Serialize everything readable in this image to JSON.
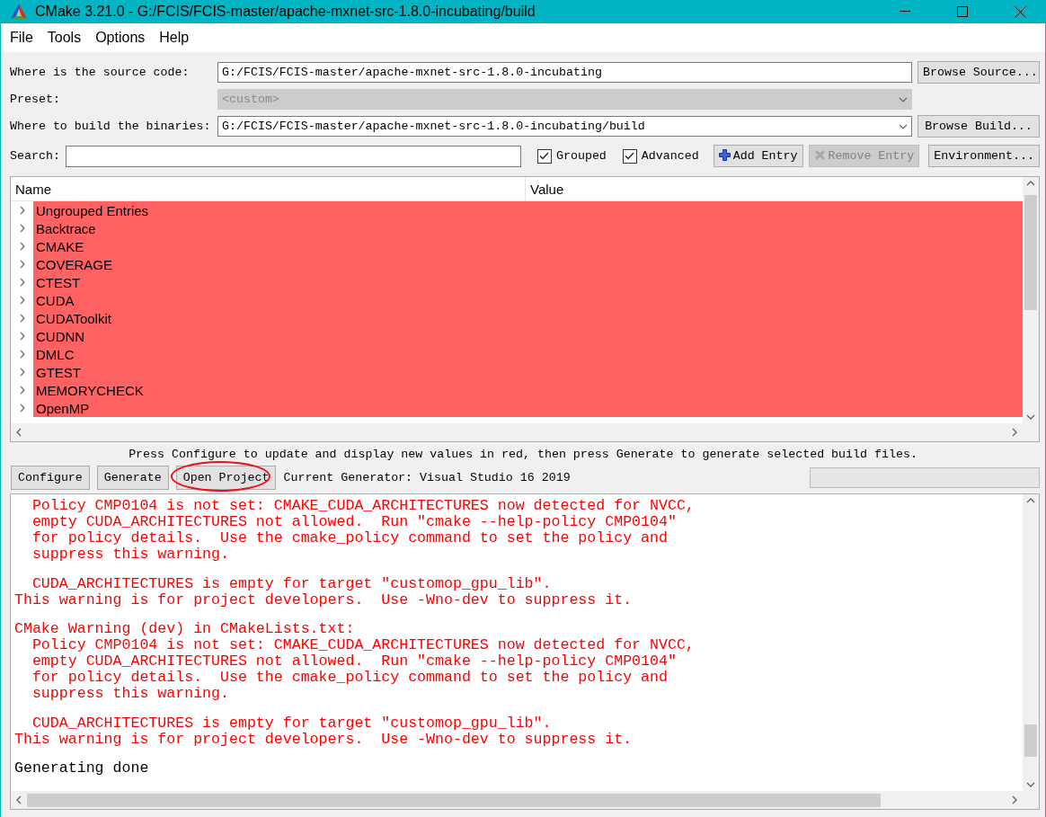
{
  "window": {
    "title": "CMake 3.21.0 - G:/FCIS/FCIS-master/apache-mxnet-src-1.8.0-incubating/build"
  },
  "menu": [
    "File",
    "Tools",
    "Options",
    "Help"
  ],
  "paths": [
    {
      "kind": "text",
      "label": "Where is the source code:",
      "value": "G:/FCIS/FCIS-master/apache-mxnet-src-1.8.0-incubating",
      "disabled": false,
      "button": "Browse Source..."
    },
    {
      "kind": "combo",
      "label": "Preset:",
      "value": "<custom>",
      "disabled": true
    },
    {
      "kind": "combo",
      "label": "Where to build the binaries:",
      "value": "G:/FCIS/FCIS-master/apache-mxnet-src-1.8.0-incubating/build",
      "disabled": false,
      "button": "Browse Build..."
    }
  ],
  "search": {
    "label": "Search:"
  },
  "options": [
    {
      "label": "Grouped",
      "checked": true
    },
    {
      "label": "Advanced",
      "checked": true
    }
  ],
  "entry_buttons": [
    {
      "kind": "add",
      "label": "Add Entry",
      "disabled": false
    },
    {
      "kind": "remove",
      "label": "Remove Entry",
      "disabled": true
    },
    {
      "kind": "plain",
      "label": "Environment...",
      "disabled": false
    }
  ],
  "table": {
    "columns": [
      "Name",
      "Value"
    ],
    "rows": [
      {
        "name": "Ungrouped Entries",
        "expanded": false,
        "changed": true
      },
      {
        "name": "Backtrace",
        "expanded": false,
        "changed": true
      },
      {
        "name": "CMAKE",
        "expanded": false,
        "changed": true
      },
      {
        "name": "COVERAGE",
        "expanded": false,
        "changed": true
      },
      {
        "name": "CTEST",
        "expanded": false,
        "changed": true
      },
      {
        "name": "CUDA",
        "expanded": false,
        "changed": true
      },
      {
        "name": "CUDAToolkit",
        "expanded": false,
        "changed": true
      },
      {
        "name": "CUDNN",
        "expanded": false,
        "changed": true
      },
      {
        "name": "DMLC",
        "expanded": false,
        "changed": true
      },
      {
        "name": "GTEST",
        "expanded": false,
        "changed": true
      },
      {
        "name": "MEMORYCHECK",
        "expanded": false,
        "changed": true
      },
      {
        "name": "OpenMP",
        "expanded": false,
        "changed": true
      }
    ]
  },
  "hint": "Press Configure to update and display new values in red, then press Generate to generate selected build files.",
  "actions": [
    {
      "label": "Configure",
      "circled": false
    },
    {
      "label": "Generate",
      "circled": false
    },
    {
      "label": "Open Project",
      "circled": true
    }
  ],
  "generator": "Current Generator: Visual Studio 16 2019",
  "progress": {
    "level": 0
  },
  "output": [
    {
      "kind": "warning",
      "lines": [
        "  Policy CMP0104 is not set: CMAKE_CUDA_ARCHITECTURES now detected for NVCC,",
        "  empty CUDA_ARCHITECTURES not allowed.  Run \"cmake --help-policy CMP0104\"",
        "  for policy details.  Use the cmake_policy command to set the policy and",
        "  suppress this warning."
      ]
    },
    {
      "kind": "warning",
      "lines": [
        "  CUDA_ARCHITECTURES is empty for target \"customop_gpu_lib\".",
        "This warning is for project developers.  Use -Wno-dev to suppress it."
      ]
    },
    {
      "kind": "warning",
      "lines": [
        "CMake Warning (dev) in CMakeLists.txt:",
        "  Policy CMP0104 is not set: CMAKE_CUDA_ARCHITECTURES now detected for NVCC,",
        "  empty CUDA_ARCHITECTURES not allowed.  Run \"cmake --help-policy CMP0104\"",
        "  for policy details.  Use the cmake_policy command to set the policy and",
        "  suppress this warning."
      ]
    },
    {
      "kind": "warning",
      "lines": [
        "  CUDA_ARCHITECTURES is empty for target \"customop_gpu_lib\".",
        "This warning is for project developers.  Use -Wno-dev to suppress it."
      ]
    },
    {
      "kind": "info",
      "lines": [
        "Generating done"
      ]
    }
  ]
}
